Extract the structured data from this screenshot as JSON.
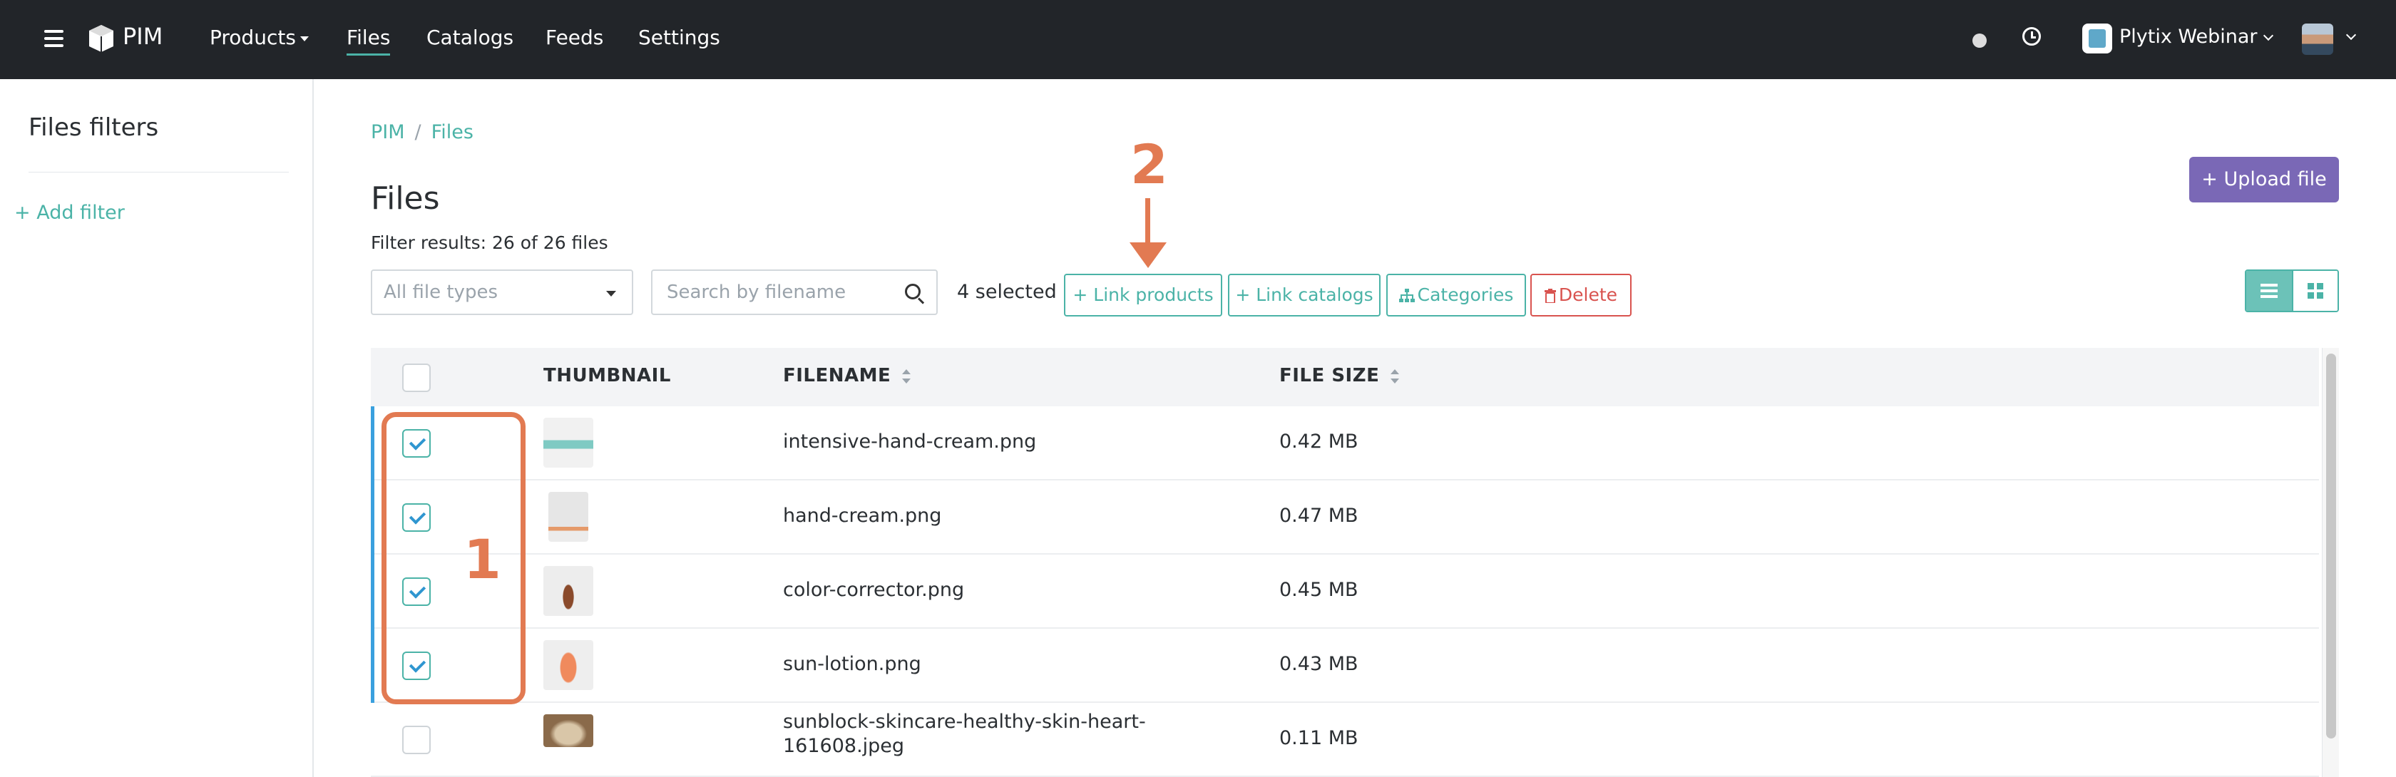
{
  "nav": {
    "logo_text": "PIM",
    "items": [
      {
        "label": "Products"
      },
      {
        "label": "Files"
      },
      {
        "label": "Catalogs"
      },
      {
        "label": "Feeds"
      },
      {
        "label": "Settings"
      }
    ],
    "account_name": "Plytix Webinar"
  },
  "sidebar": {
    "title": "Files filters",
    "add_filter": "+ Add filter"
  },
  "breadcrumb": [
    "PIM",
    "Files"
  ],
  "page": {
    "title": "Files",
    "filter_results": "Filter results: 26 of 26 files",
    "upload_button": "+ Upload file"
  },
  "toolbar": {
    "file_type_select": "All file types",
    "search_placeholder": "Search by filename",
    "selected_count": "4 selected",
    "link_products": "+ Link products",
    "link_catalogs": "+ Link catalogs",
    "categories": "Categories",
    "delete": "Delete"
  },
  "table": {
    "columns": [
      "THUMBNAIL",
      "FILENAME",
      "FILE SIZE"
    ],
    "rows": [
      {
        "filename": "intensive-hand-cream.png",
        "size": "0.42 MB",
        "checked": true
      },
      {
        "filename": "hand-cream.png",
        "size": "0.47 MB",
        "checked": true
      },
      {
        "filename": "color-corrector.png",
        "size": "0.45 MB",
        "checked": true
      },
      {
        "filename": "sun-lotion.png",
        "size": "0.43 MB",
        "checked": true
      },
      {
        "filename_line1": "sunblock-skincare-healthy-skin-heart-",
        "filename_line2": "161608.jpeg",
        "size": "0.11 MB",
        "checked": false
      }
    ]
  },
  "annotations": {
    "one": "1",
    "two": "2"
  },
  "colors": {
    "accent": "#4bb3a7",
    "upload": "#7a68b6",
    "danger": "#d9534f",
    "annotation": "#e27a52",
    "topbar": "#222529"
  }
}
